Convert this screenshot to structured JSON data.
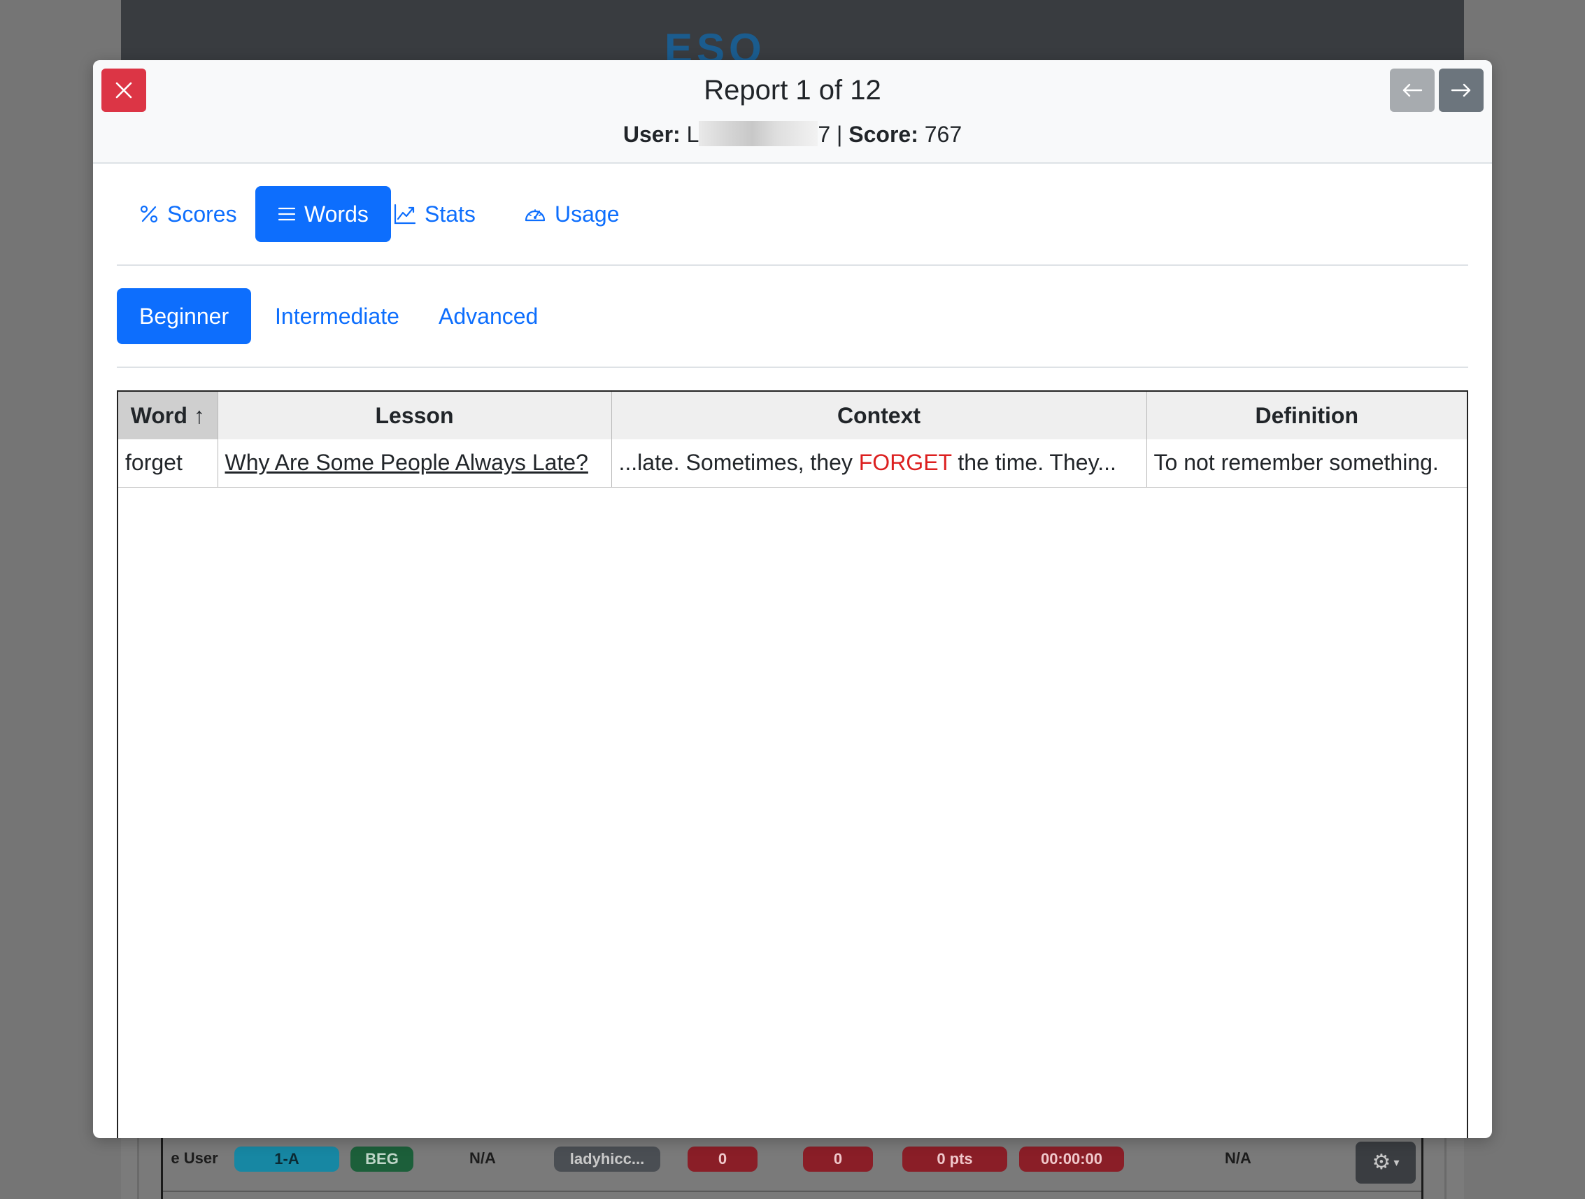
{
  "background": {
    "logo_text": "ESO",
    "row": {
      "user_cell": "e User",
      "level_badge": "1-A",
      "tier_badge": "BEG",
      "col_na_1": "N/A",
      "username_badge": "ladyhicc...",
      "count_1": "0",
      "count_2": "0",
      "points": "0 pts",
      "time": "00:00:00",
      "col_na_2": "N/A"
    }
  },
  "modal": {
    "title": "Report 1 of 12",
    "subtitle": {
      "user_label": "User:",
      "user_prefix": "L",
      "user_suffix": "7",
      "separator": "|",
      "score_label": "Score:",
      "score_value": "767"
    },
    "tabs": [
      {
        "label": "Scores",
        "icon": "percent-icon",
        "active": false
      },
      {
        "label": "Words",
        "icon": "list-icon",
        "active": true
      },
      {
        "label": "Stats",
        "icon": "chart-line-icon",
        "active": false
      },
      {
        "label": "Usage",
        "icon": "speedometer-icon",
        "active": false
      }
    ],
    "subtabs": [
      {
        "label": "Beginner",
        "active": true
      },
      {
        "label": "Intermediate",
        "active": false
      },
      {
        "label": "Advanced",
        "active": false
      }
    ],
    "table": {
      "headers": {
        "word": "Word",
        "lesson": "Lesson",
        "context": "Context",
        "definition": "Definition"
      },
      "sort_indicator": "↑",
      "rows": [
        {
          "word": "forget",
          "lesson": "Why Are Some People Always Late?",
          "context_before": "...late. Sometimes, they ",
          "context_highlight": "FORGET",
          "context_after": " the time. They...",
          "definition": "To not remember something."
        }
      ]
    }
  },
  "colors": {
    "primary": "#0d6efd",
    "danger": "#dc3545",
    "secondary": "#6c757d",
    "highlight": "#dc1f1f"
  }
}
